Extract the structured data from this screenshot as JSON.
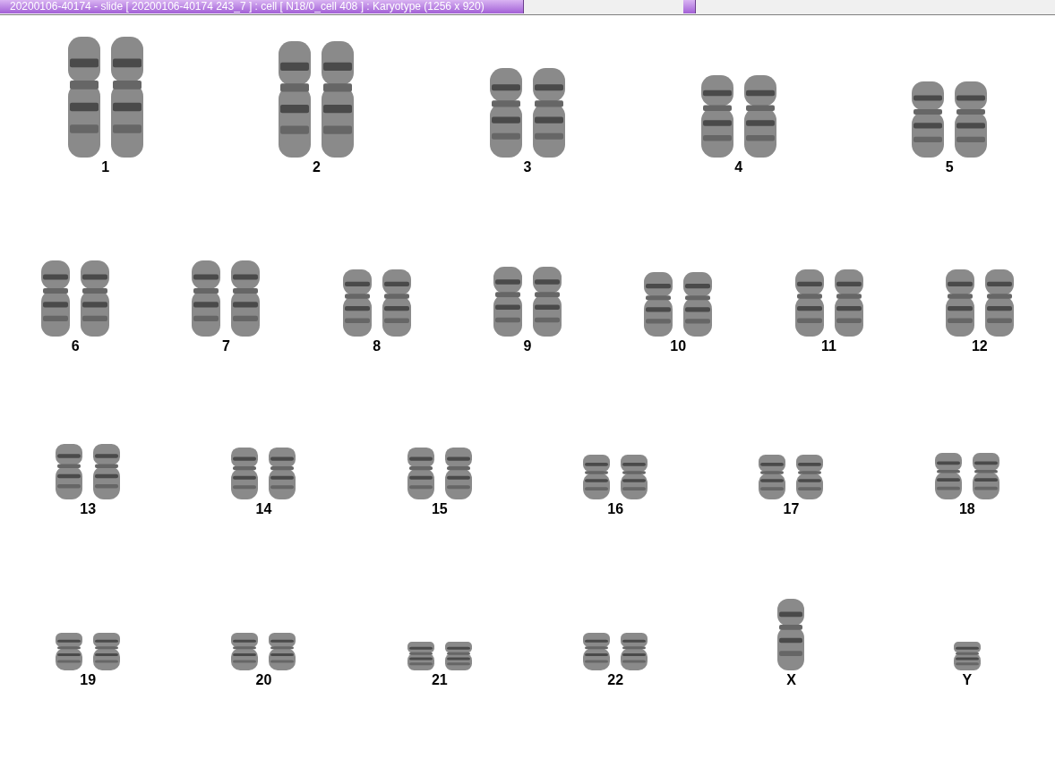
{
  "title_bar": {
    "title": "20200106-40174 - slide [ 20200106-40174 243_7 ] : cell [ N18/0_cell 408 ] : Karyotype  (1256 x 920)"
  },
  "karyotype": {
    "rows": [
      [
        {
          "label": "1",
          "kind": "pair"
        },
        {
          "label": "2",
          "kind": "pair"
        },
        {
          "label": "3",
          "kind": "pair"
        },
        {
          "label": "4",
          "kind": "pair"
        },
        {
          "label": "5",
          "kind": "pair"
        }
      ],
      [
        {
          "label": "6",
          "kind": "pair"
        },
        {
          "label": "7",
          "kind": "pair"
        },
        {
          "label": "8",
          "kind": "pair"
        },
        {
          "label": "9",
          "kind": "pair"
        },
        {
          "label": "10",
          "kind": "pair"
        },
        {
          "label": "11",
          "kind": "pair"
        },
        {
          "label": "12",
          "kind": "pair"
        }
      ],
      [
        {
          "label": "13",
          "kind": "pair"
        },
        {
          "label": "14",
          "kind": "pair"
        },
        {
          "label": "15",
          "kind": "pair"
        },
        {
          "label": "16",
          "kind": "pair"
        },
        {
          "label": "17",
          "kind": "pair"
        },
        {
          "label": "18",
          "kind": "pair"
        }
      ],
      [
        {
          "label": "19",
          "kind": "pair"
        },
        {
          "label": "20",
          "kind": "pair"
        },
        {
          "label": "21",
          "kind": "pair"
        },
        {
          "label": "22",
          "kind": "pair"
        },
        {
          "label": "X",
          "kind": "single"
        },
        {
          "label": "Y",
          "kind": "single"
        }
      ]
    ]
  }
}
